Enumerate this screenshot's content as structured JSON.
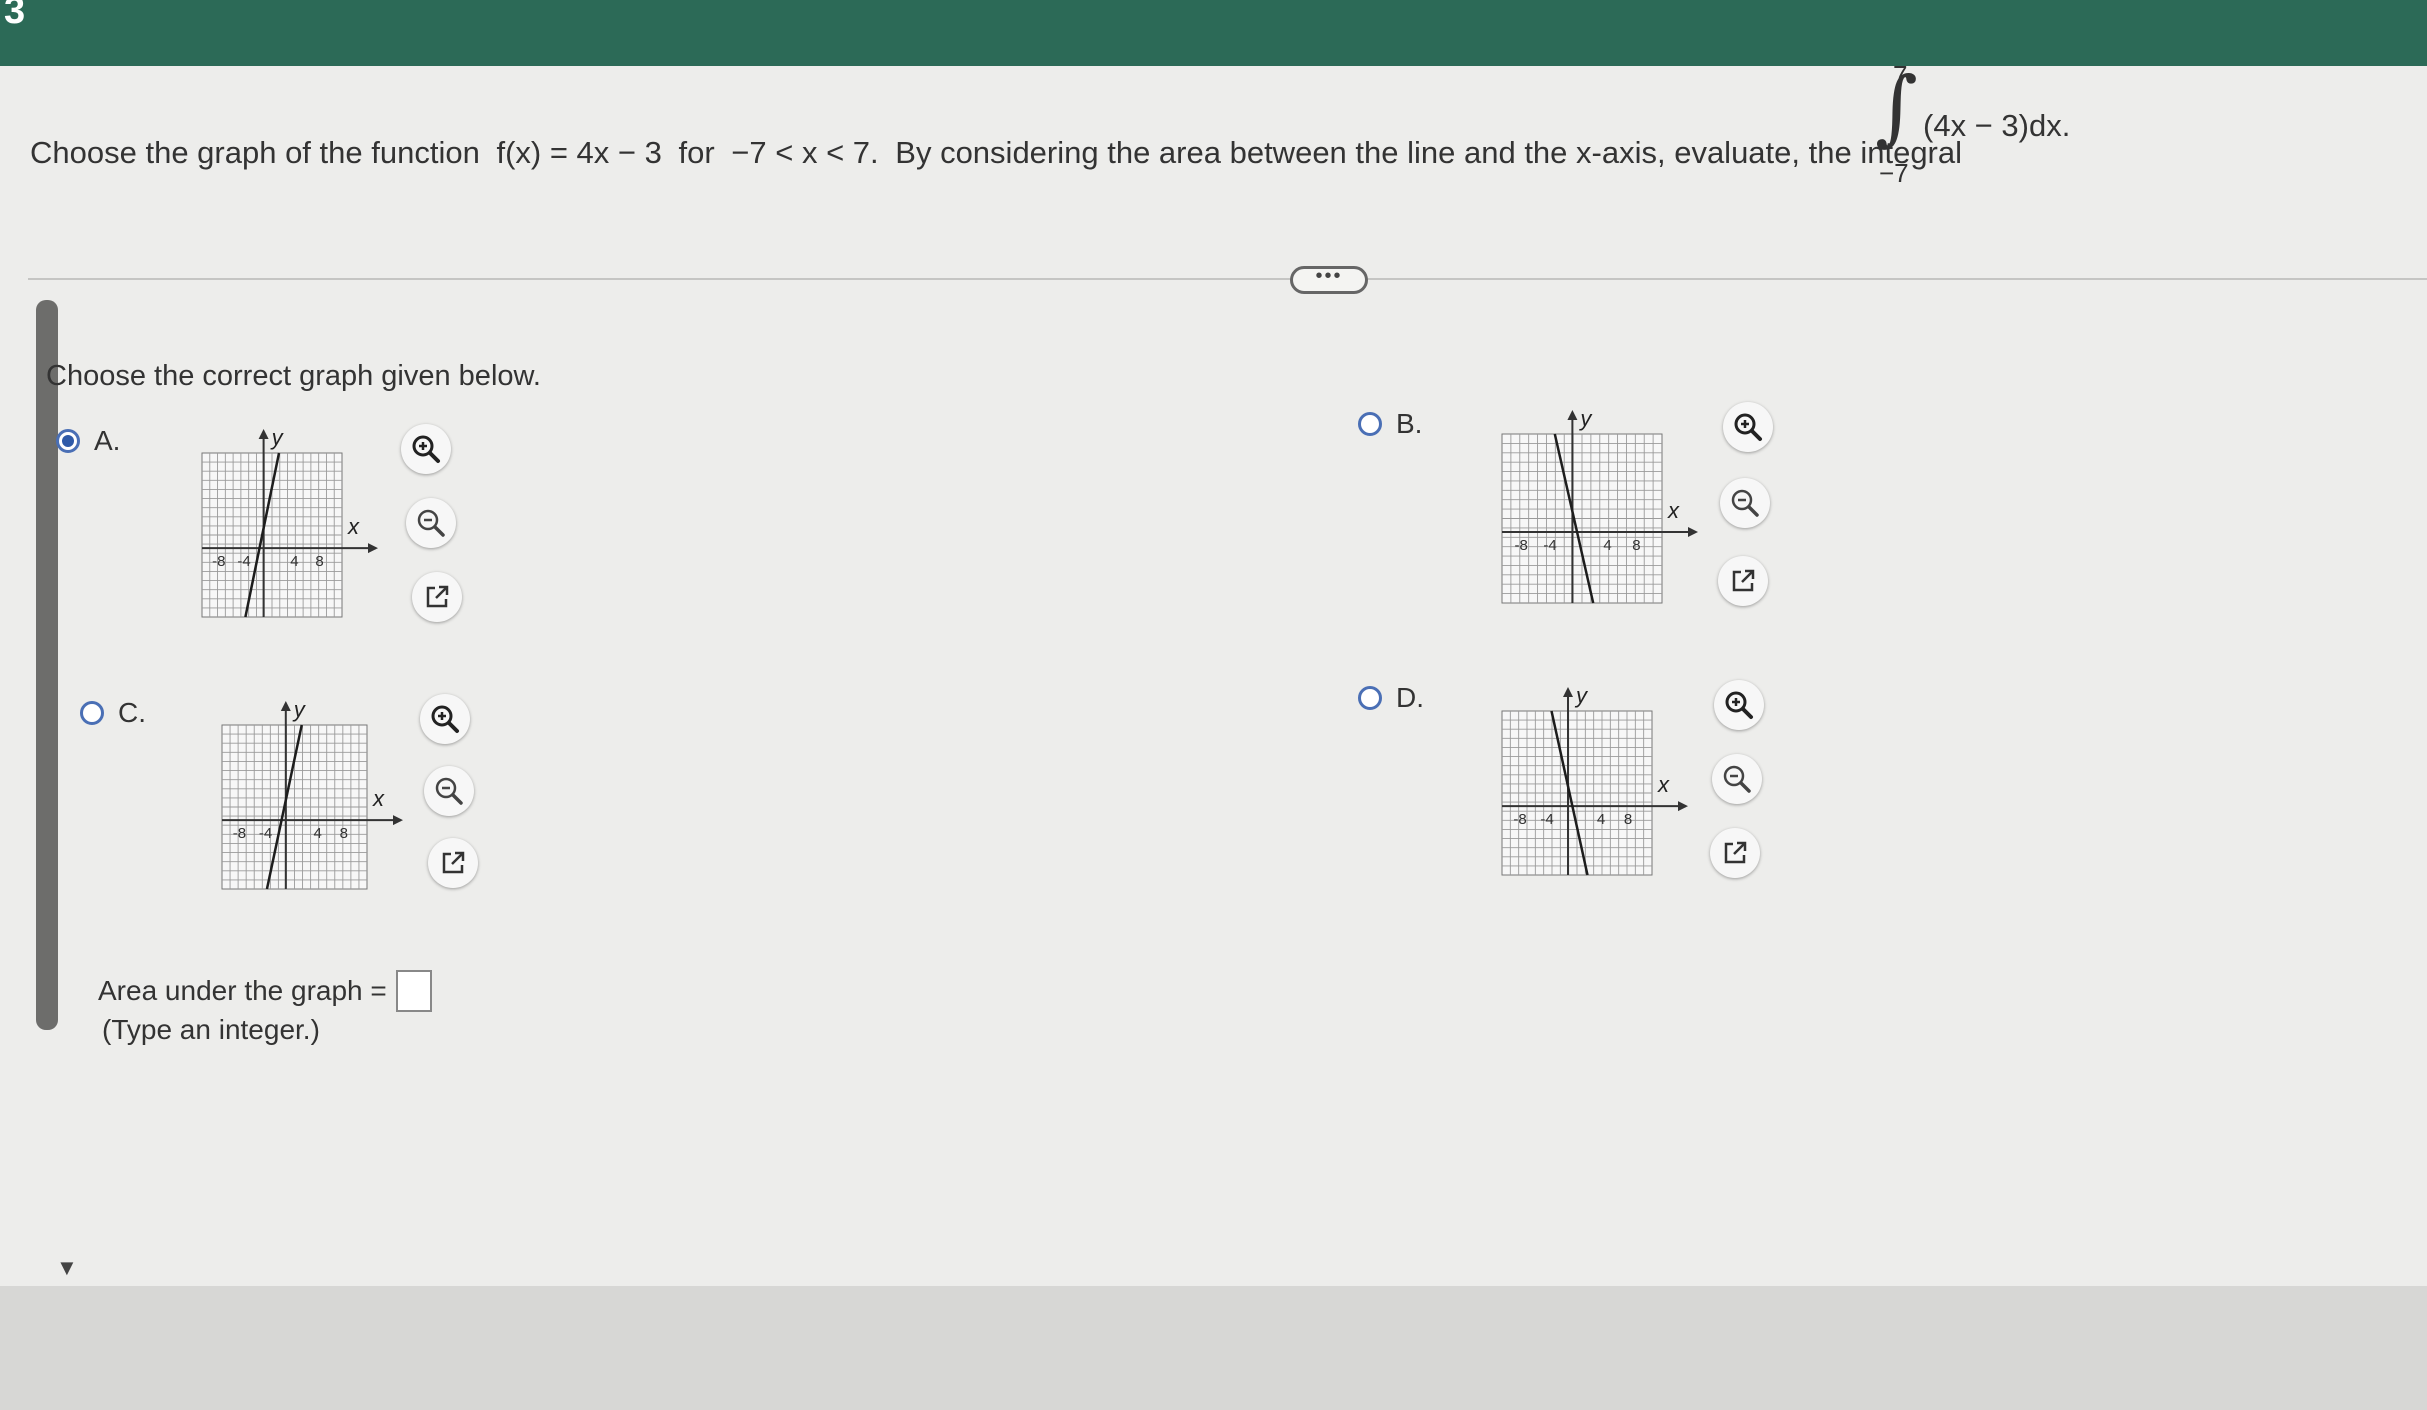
{
  "header": {
    "question_number": "3"
  },
  "question": {
    "prefix": "Choose the graph of the function",
    "function": "f(x) = 4x − 3",
    "for_word": "for",
    "domain": "−7 < x < 7.",
    "suffix": "By considering the area between the line and the x-axis, evaluate, the integral",
    "integral": {
      "upper": "7",
      "lower": "−7",
      "integrand": "(4x − 3)dx."
    }
  },
  "more_button_label": "•••",
  "instruction": "Choose the correct graph given below.",
  "options": [
    {
      "letter": "A.",
      "selected": true,
      "slope": "positive"
    },
    {
      "letter": "B.",
      "selected": false,
      "slope": "negative"
    },
    {
      "letter": "C.",
      "selected": false,
      "slope": "positive"
    },
    {
      "letter": "D.",
      "selected": false,
      "slope": "negative"
    }
  ],
  "graph_labels": {
    "x": "x",
    "y": "y",
    "ticks": [
      "-8",
      "-4",
      "4",
      "8"
    ]
  },
  "tools": [
    "zoom-in-icon",
    "zoom-out-icon",
    "external-link-icon"
  ],
  "answer": {
    "label": "Area under the graph =",
    "value": "",
    "hint": "(Type an integer.)"
  },
  "colors": {
    "header": "#2c6a57",
    "radio": "#2f5aa8"
  }
}
